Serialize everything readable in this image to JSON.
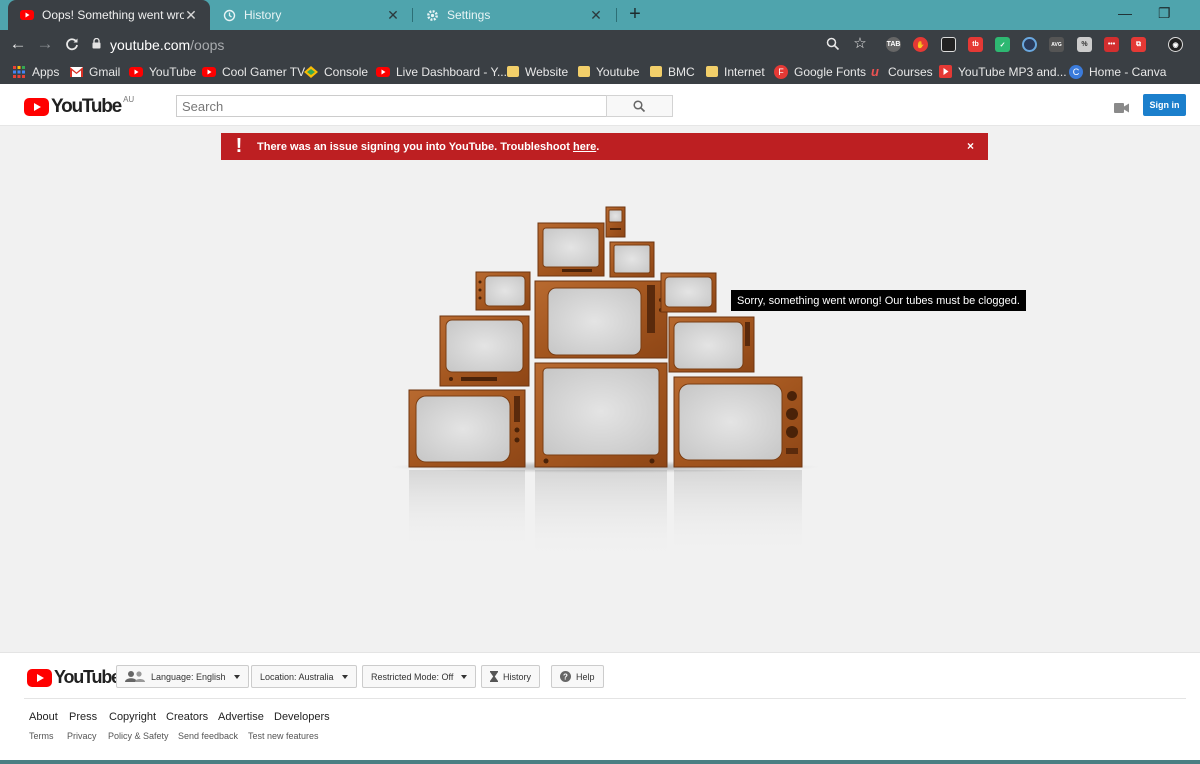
{
  "tabs": [
    {
      "title": "Oops! Something went wrong. -",
      "icon": "youtube-favicon",
      "active": true
    },
    {
      "title": "History",
      "icon": "history-icon",
      "active": false
    },
    {
      "title": "Settings",
      "icon": "gear-icon",
      "active": false
    }
  ],
  "address_bar": {
    "host": "youtube.com",
    "path": "/oops"
  },
  "bookmarks": [
    {
      "label": "Apps",
      "icon": "apps-grid-icon"
    },
    {
      "label": "Gmail",
      "icon": "gmail-icon"
    },
    {
      "label": "YouTube",
      "icon": "youtube-icon"
    },
    {
      "label": "Cool Gamer TV",
      "icon": "youtube-icon"
    },
    {
      "label": "Console",
      "icon": "console-icon"
    },
    {
      "label": "Live Dashboard - Y...",
      "icon": "youtube-icon"
    },
    {
      "label": "Website",
      "icon": "folder-icon"
    },
    {
      "label": "Youtube",
      "icon": "folder-icon"
    },
    {
      "label": "BMC",
      "icon": "folder-icon"
    },
    {
      "label": "Internet",
      "icon": "folder-icon"
    },
    {
      "label": "Google Fonts",
      "icon": "google-fonts-icon"
    },
    {
      "label": "Courses",
      "icon": "udemy-icon"
    },
    {
      "label": "YouTube MP3 and...",
      "icon": "youtube-mp3-icon"
    },
    {
      "label": "Home - Canva",
      "icon": "canva-icon"
    }
  ],
  "extensions": {
    "tab_label": "TAB",
    "tubebuddy_label": "tb",
    "avg_label": "AVG",
    "dots_label": "•••"
  },
  "yt_header": {
    "logo_text": "YouTube",
    "region": "AU",
    "search_placeholder": "Search",
    "sign_in": "Sign in"
  },
  "alert": {
    "message": "There was an issue signing you into YouTube. Troubleshoot ",
    "link_text": "here",
    "suffix": ".",
    "close": "×"
  },
  "error_message": "Sorry, something went wrong! Our tubes must be clogged.",
  "footer": {
    "logo_text": "YouTube",
    "language": "Language: English",
    "location": "Location: Australia",
    "restricted": "Restricted Mode: Off",
    "history": "History",
    "help": "Help",
    "links": [
      "About",
      "Press",
      "Copyright",
      "Creators",
      "Advertise",
      "Developers"
    ],
    "sublinks": [
      "Terms",
      "Privacy",
      "Policy & Safety",
      "Send feedback",
      "Test new features"
    ]
  },
  "colors": {
    "tab_strip": "#4fa4ad",
    "chrome_dark": "#3a3f44",
    "youtube_red": "#ff0000",
    "alert_red": "#bd1f22",
    "signin_blue": "#1b7fcc",
    "tv_wood": "#a85a24"
  }
}
